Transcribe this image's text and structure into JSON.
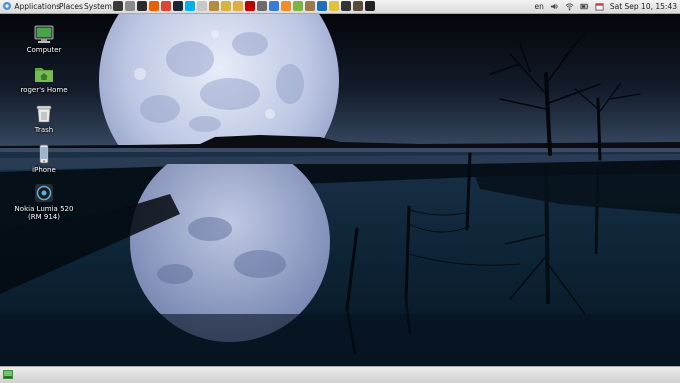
{
  "top_panel": {
    "menus": [
      "Applications",
      "Places",
      "System"
    ],
    "launchers": [
      {
        "icon": "terminal-icon",
        "color": "#3a3a3a"
      },
      {
        "icon": "file-manager-icon",
        "color": "#8a8a8a"
      },
      {
        "icon": "browser-icon",
        "color": "#2b2b2b"
      },
      {
        "icon": "firefox-icon",
        "color": "#e66000"
      },
      {
        "icon": "chrome-icon",
        "color": "#db4437"
      },
      {
        "icon": "steam-icon",
        "color": "#1b2838"
      },
      {
        "icon": "skype-icon",
        "color": "#00aff0"
      },
      {
        "icon": "text-editor-icon",
        "color": "#c7c7c7"
      },
      {
        "icon": "archive-icon",
        "color": "#b38c3c"
      },
      {
        "icon": "image-viewer-icon",
        "color": "#d9b23c"
      },
      {
        "icon": "folder-icon",
        "color": "#e1ad43"
      },
      {
        "icon": "filezilla-icon",
        "color": "#bf0000"
      },
      {
        "icon": "calculator-icon",
        "color": "#6b6b6b"
      },
      {
        "icon": "network-icon",
        "color": "#3a7bd5"
      },
      {
        "icon": "photos-icon",
        "color": "#f08d2a"
      },
      {
        "icon": "android-icon",
        "color": "#7cb342"
      },
      {
        "icon": "package-icon",
        "color": "#9a7a4a"
      },
      {
        "icon": "virtualbox-icon",
        "color": "#1c6fbb"
      },
      {
        "icon": "tools-icon",
        "color": "#e2c23a"
      },
      {
        "icon": "monitor-icon",
        "color": "#333333"
      },
      {
        "icon": "film-icon",
        "color": "#5a4a3a"
      },
      {
        "icon": "console-icon",
        "color": "#222222"
      }
    ],
    "keyboard_layout": "en",
    "clock": "Sat Sep 10, 15:43"
  },
  "desktop": {
    "icons": [
      {
        "label": "Computer",
        "icon": "computer-icon"
      },
      {
        "label": "roger's Home",
        "icon": "home-folder-icon"
      },
      {
        "label": "Trash",
        "icon": "trash-icon"
      },
      {
        "label": "iPhone",
        "icon": "phone-icon"
      },
      {
        "label": "Nokia Lumia 520",
        "label2": "(RM 914)",
        "icon": "media-player-icon"
      }
    ]
  },
  "colors": {
    "panel": "#e3e3e3",
    "sky_dark": "#05080f",
    "water": "#0b2236",
    "moon": "#c9d2ea"
  }
}
